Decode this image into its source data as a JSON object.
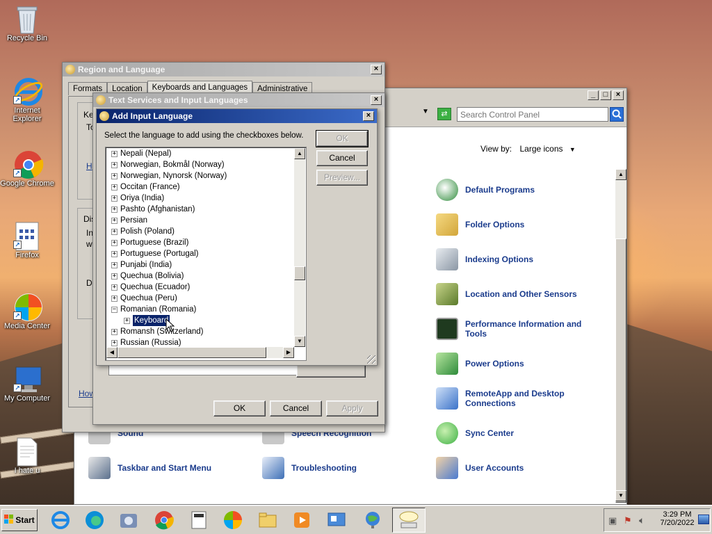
{
  "desktop": {
    "icons": [
      {
        "label": "Recycle Bin",
        "icon": "recycle-bin-icon"
      },
      {
        "label": "Internet Explorer",
        "icon": "internet-explorer-icon"
      },
      {
        "label": "Google Chrome",
        "icon": "chrome-icon"
      },
      {
        "label": "Firefox",
        "icon": "firefox-icon"
      },
      {
        "label": "Media Center",
        "icon": "media-center-icon"
      },
      {
        "label": "My Computer",
        "icon": "computer-icon"
      },
      {
        "label": "I hate u",
        "icon": "text-file-icon"
      }
    ]
  },
  "control_panel": {
    "search_placeholder": "Search Control Panel",
    "view_by_label": "View by:",
    "view_by_value": "Large icons",
    "items": [
      {
        "label": "Default Programs",
        "icon": "default-programs-icon",
        "color": "#2e8b3a"
      },
      {
        "label": "Folder Options",
        "icon": "folder-options-icon",
        "color": "#e0b84a"
      },
      {
        "label": "Indexing Options",
        "icon": "indexing-options-icon",
        "color": "#9aa4b0"
      },
      {
        "label": "Location and Other Sensors",
        "icon": "location-sensors-icon",
        "color": "#6b8f3a"
      },
      {
        "label": "Performance Information and Tools",
        "icon": "performance-icon",
        "color": "#2a4d2a"
      },
      {
        "label": "Power Options",
        "icon": "power-options-icon",
        "color": "#3aa64a"
      },
      {
        "label": "RemoteApp and Desktop Connections",
        "icon": "remoteapp-icon",
        "color": "#3a72c9"
      },
      {
        "label": "Sync Center",
        "icon": "sync-center-icon",
        "color": "#3cb043"
      },
      {
        "label": "User Accounts",
        "icon": "user-accounts-icon",
        "color": "#4a7ad0"
      },
      {
        "label": "Taskbar and Start Menu",
        "icon": "taskbar-start-icon",
        "color": "#5a6f8c"
      },
      {
        "label": "Troubleshooting",
        "icon": "troubleshooting-icon",
        "color": "#3d6fb6"
      },
      {
        "label": "Sound",
        "icon": "sound-icon",
        "color": "#8a8a8a"
      },
      {
        "label": "Speech Recognition",
        "icon": "speech-recognition-icon",
        "color": "#8a8a8a"
      }
    ]
  },
  "region_window": {
    "title": "Region and Language",
    "tabs": [
      "Formats",
      "Location",
      "Keyboards and Languages",
      "Administrative"
    ],
    "partial_labels": {
      "ke": "Ke",
      "to": "To",
      "h": "H",
      "dis": "Dis",
      "in": "In",
      "w": "w",
      "d": "D",
      "how": "How"
    },
    "buttons": {
      "ok": "OK",
      "cancel": "Cancel",
      "apply": "Apply"
    }
  },
  "text_services_window": {
    "title": "Text Services and Input Languages"
  },
  "add_language_dialog": {
    "title": "Add Input Language",
    "instruction": "Select the language to add using the checkboxes below.",
    "buttons": {
      "ok": "OK",
      "cancel": "Cancel",
      "preview": "Preview..."
    },
    "languages": [
      "Nepali (Nepal)",
      "Norwegian, Bokmål (Norway)",
      "Norwegian, Nynorsk (Norway)",
      "Occitan (France)",
      "Oriya (India)",
      "Pashto (Afghanistan)",
      "Persian",
      "Polish (Poland)",
      "Portuguese (Brazil)",
      "Portuguese (Portugal)",
      "Punjabi (India)",
      "Quechua (Bolivia)",
      "Quechua (Ecuador)",
      "Quechua (Peru)",
      "Romanian (Romania)",
      "Romansh (Switzerland)",
      "Russian (Russia)"
    ],
    "expanded_child": "Keyboard"
  },
  "taskbar": {
    "start_label": "Start",
    "time": "3:29 PM",
    "date": "7/20/2022"
  }
}
